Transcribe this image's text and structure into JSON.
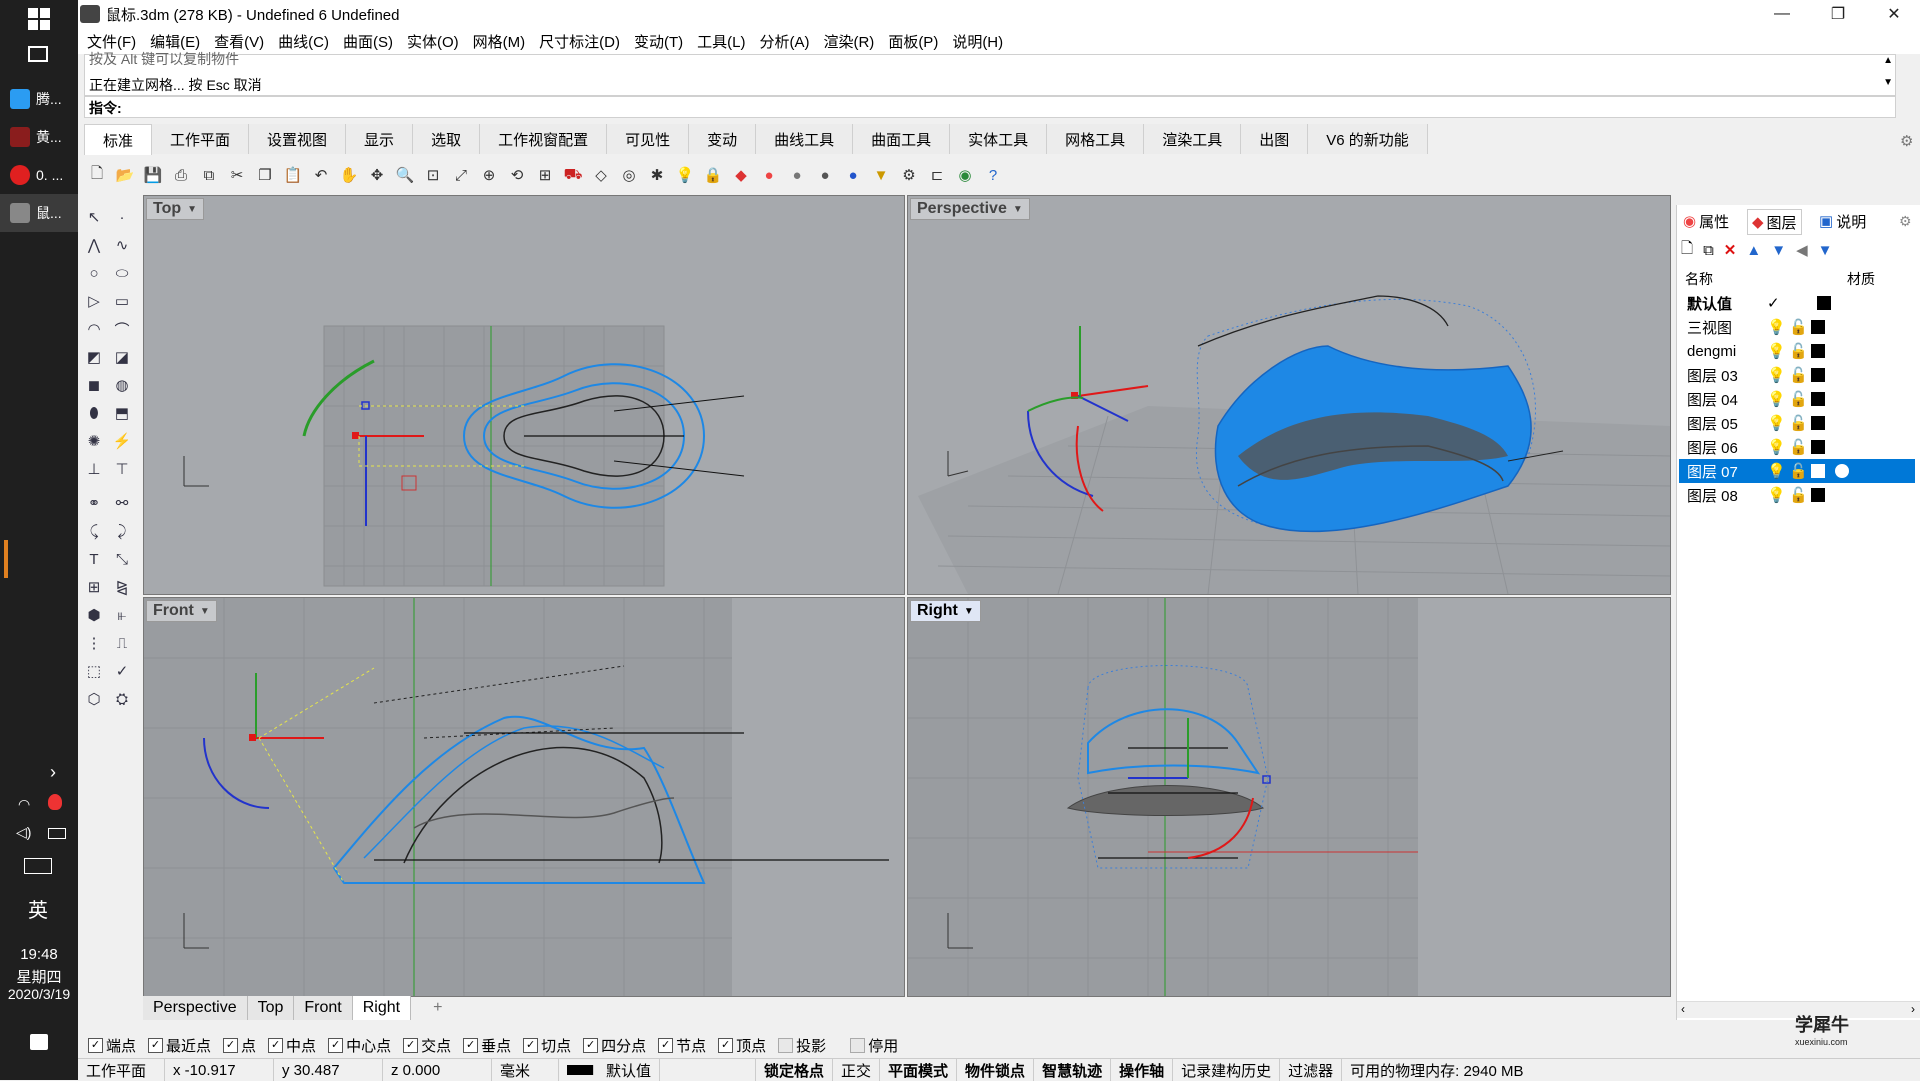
{
  "taskbar": {
    "apps": [
      {
        "label": "腾...",
        "color": "#2b9cf2"
      },
      {
        "label": "黄...",
        "color": "#3a3a3a"
      },
      {
        "label": "0. ...",
        "color": "#e02020"
      },
      {
        "label": "鼠...",
        "color": "#6a6a6a"
      }
    ],
    "ime": "英",
    "time": "19:48",
    "weekday": "星期四",
    "date": "2020/3/19"
  },
  "window": {
    "title": "鼠标.3dm (278 KB) - Undefined 6 Undefined",
    "minimize": "—",
    "restore": "❐",
    "close": "✕"
  },
  "menu": [
    "文件(F)",
    "编辑(E)",
    "查看(V)",
    "曲线(C)",
    "曲面(S)",
    "实体(O)",
    "网格(M)",
    "尺寸标注(D)",
    "变动(T)",
    "工具(L)",
    "分析(A)",
    "渲染(R)",
    "面板(P)",
    "说明(H)"
  ],
  "command": {
    "history_line1": "按及 Alt 键可以复制物件",
    "history_line2": "正在建立网格... 按 Esc 取消",
    "prompt": "指令:"
  },
  "tabs": [
    "标准",
    "工作平面",
    "设置视图",
    "显示",
    "选取",
    "工作视窗配置",
    "可见性",
    "变动",
    "曲线工具",
    "曲面工具",
    "实体工具",
    "网格工具",
    "渲染工具",
    "出图",
    "V6 的新功能"
  ],
  "viewports": {
    "top": "Top",
    "perspective": "Perspective",
    "front": "Front",
    "right": "Right"
  },
  "viewport_tabs": [
    "Perspective",
    "Top",
    "Front",
    "Right",
    "+"
  ],
  "panel": {
    "tabs": [
      "属性",
      "图层",
      "说明"
    ],
    "col_name": "名称",
    "col_material": "材质",
    "layers": [
      {
        "name": "默认值",
        "current": true,
        "selected": false
      },
      {
        "name": "三视图",
        "current": false,
        "selected": false
      },
      {
        "name": "dengmi",
        "current": false,
        "selected": false
      },
      {
        "name": "图层 03",
        "current": false,
        "selected": false
      },
      {
        "name": "图层 04",
        "current": false,
        "selected": false
      },
      {
        "name": "图层 05",
        "current": false,
        "selected": false
      },
      {
        "name": "图层 06",
        "current": false,
        "selected": false
      },
      {
        "name": "图层 07",
        "current": false,
        "selected": true
      },
      {
        "name": "图层 08",
        "current": false,
        "selected": false
      }
    ],
    "watermark": "学犀牛",
    "watermark_url": "xuexiniu.com"
  },
  "snaps": [
    {
      "label": "端点",
      "checked": true
    },
    {
      "label": "最近点",
      "checked": true
    },
    {
      "label": "点",
      "checked": true
    },
    {
      "label": "中点",
      "checked": true
    },
    {
      "label": "中心点",
      "checked": true
    },
    {
      "label": "交点",
      "checked": true
    },
    {
      "label": "垂点",
      "checked": true
    },
    {
      "label": "切点",
      "checked": true
    },
    {
      "label": "四分点",
      "checked": true
    },
    {
      "label": "节点",
      "checked": true
    },
    {
      "label": "顶点",
      "checked": true
    },
    {
      "label": "投影",
      "checked": false
    },
    {
      "label": "停用",
      "checked": false
    }
  ],
  "status": {
    "cplane": "工作平面",
    "x": "x -10.917",
    "y": "y 30.487",
    "z": "z 0.000",
    "units": "毫米",
    "layer": "默认值",
    "grid_snap": "锁定格点",
    "ortho": "正交",
    "planar": "平面模式",
    "osnap": "物件锁点",
    "smarttrack": "智慧轨迹",
    "gumball": "操作轴",
    "history": "记录建构历史",
    "filter": "过滤器",
    "memory": "可用的物理内存: 2940 MB"
  },
  "colors": {
    "surface_blue": "#1e88e5",
    "viewport_bg": "#a6a9ad",
    "selection": "#0078d7"
  }
}
